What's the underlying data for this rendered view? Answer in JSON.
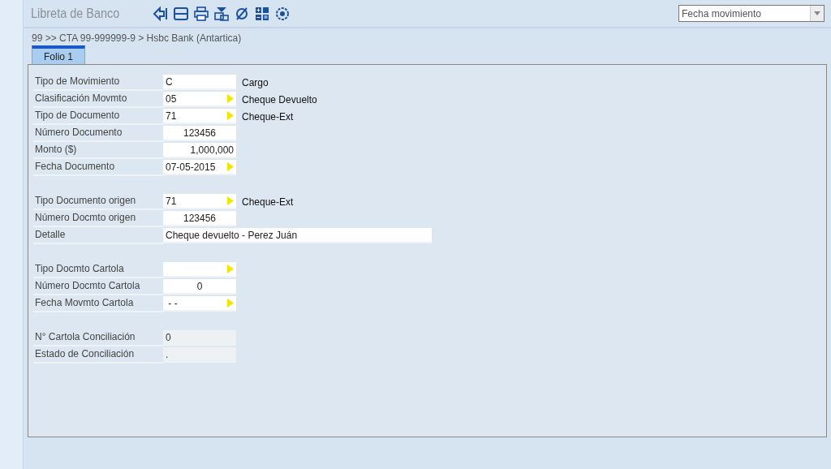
{
  "window": {
    "title": "Libreta de Banco"
  },
  "sort_select": {
    "value": "Fecha movimiento"
  },
  "breadcrumb": "99 >> CTA 99-999999-9 > Hsbc Bank  (Antartica)",
  "tabs": [
    {
      "label": "Folio 1",
      "selected": true
    }
  ],
  "groups": [
    {
      "fields": [
        {
          "label": "Tipo de Movimiento",
          "kind": "text",
          "value": "C",
          "description": "Cargo"
        },
        {
          "label": "Clasificación Movmto",
          "kind": "lookup",
          "value": "05",
          "description": "Cheque Devuelto"
        },
        {
          "label": "Tipo de Documento",
          "kind": "lookup",
          "value": "71",
          "description": "Cheque-Ext"
        },
        {
          "label": "Número Documento",
          "kind": "number",
          "value": "123456"
        },
        {
          "label": "Monto ($)",
          "kind": "amount",
          "value": "1,000,000"
        },
        {
          "label": "Fecha Documento",
          "kind": "lookup",
          "value": "07-05-2015"
        }
      ]
    },
    {
      "fields": [
        {
          "label": "Tipo Documento origen",
          "kind": "lookup",
          "value": "71",
          "description": "Cheque-Ext"
        },
        {
          "label": "Número Docmto origen",
          "kind": "number",
          "value": "123456"
        },
        {
          "label": "Detalle",
          "kind": "wide",
          "value": "Cheque devuelto - Perez Juán"
        }
      ]
    },
    {
      "fields": [
        {
          "label": "Tipo Docmto Cartola",
          "kind": "lookup"
        },
        {
          "label": "Número Docmto Cartola",
          "kind": "number",
          "value": "0"
        },
        {
          "label": "Fecha Movmto Cartola",
          "kind": "lookup",
          "value": " - -"
        }
      ]
    },
    {
      "fields": [
        {
          "label": "N° Cartola Conciliación",
          "kind": "readonly",
          "value": "0"
        },
        {
          "label": "Estado de Conciliación",
          "kind": "readonly",
          "value": "."
        }
      ]
    }
  ]
}
